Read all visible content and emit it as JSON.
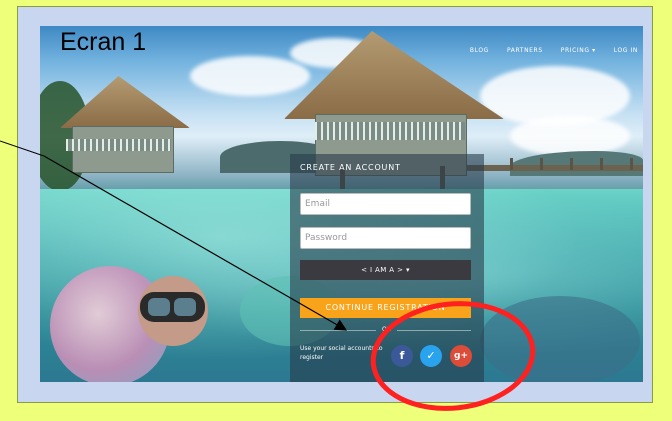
{
  "annotation": {
    "title": "Ecran 1"
  },
  "nav": {
    "items": [
      {
        "label": "BLOG"
      },
      {
        "label": "PARTNERS"
      },
      {
        "label": "PRICING ▾"
      },
      {
        "label": "LOG IN"
      }
    ]
  },
  "signup": {
    "heading": "CREATE AN ACCOUNT",
    "email_placeholder": "Email",
    "password_placeholder": "Password",
    "role_label": "< I AM A >  ▾",
    "continue_label": "CONTINUE REGISTRATION",
    "or_label": "OR",
    "social_hint": "Use your social accounts to register",
    "social": [
      {
        "glyph": "f",
        "icon": "facebook-icon",
        "color": "#3b5998"
      },
      {
        "glyph": "✓",
        "icon": "twitter-icon",
        "color": "#2aa3ef"
      },
      {
        "glyph": "g+",
        "icon": "google-plus-icon",
        "color": "#dd4b39"
      }
    ]
  },
  "colors": {
    "page_background": "#eeff7a",
    "accent_orange": "#f9a31a",
    "annotation_circle": "#ff2020"
  }
}
